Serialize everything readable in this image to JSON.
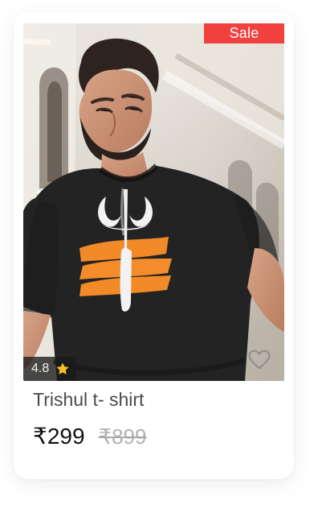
{
  "card": {
    "badge": "Sale",
    "rating": {
      "value": "4.8",
      "icon": "star-icon",
      "color": "#f6bf26"
    },
    "wishlist": {
      "icon": "heart-outline-icon",
      "color": "#8d8d8d"
    },
    "product": {
      "title": "Trishul t- shirt",
      "price": "₹299",
      "original_price": "₹899"
    },
    "colors": {
      "badge": "#f1413e",
      "tshirt": "#222222",
      "accent_orange": "#f28a28"
    }
  }
}
